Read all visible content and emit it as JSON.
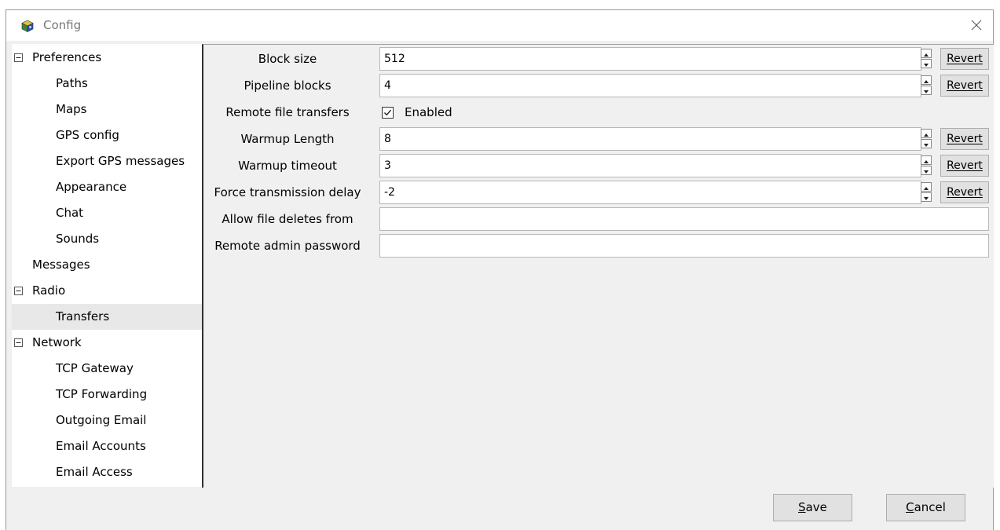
{
  "window": {
    "title": "Config",
    "close_glyph": "✕"
  },
  "tree": [
    {
      "label": "Preferences",
      "level": 0,
      "expander": "⊟",
      "selected": false
    },
    {
      "label": "Paths",
      "level": 1,
      "selected": false
    },
    {
      "label": "Maps",
      "level": 1,
      "selected": false
    },
    {
      "label": "GPS config",
      "level": 1,
      "selected": false
    },
    {
      "label": "Export GPS messages",
      "level": 1,
      "selected": false
    },
    {
      "label": "Appearance",
      "level": 1,
      "selected": false
    },
    {
      "label": "Chat",
      "level": 1,
      "selected": false
    },
    {
      "label": "Sounds",
      "level": 1,
      "selected": false
    },
    {
      "label": "Messages",
      "level": 0,
      "selected": false
    },
    {
      "label": "Radio",
      "level": 0,
      "expander": "⊟",
      "selected": false
    },
    {
      "label": "Transfers",
      "level": 1,
      "selected": true
    },
    {
      "label": "Network",
      "level": 0,
      "expander": "⊟",
      "selected": false
    },
    {
      "label": "TCP Gateway",
      "level": 1,
      "selected": false
    },
    {
      "label": "TCP Forwarding",
      "level": 1,
      "selected": false
    },
    {
      "label": "Outgoing Email",
      "level": 1,
      "selected": false
    },
    {
      "label": "Email Accounts",
      "level": 1,
      "selected": false
    },
    {
      "label": "Email Access",
      "level": 1,
      "selected": false
    }
  ],
  "settings": {
    "revert_label": "Revert",
    "block_size": {
      "label": "Block size",
      "value": "512"
    },
    "pipeline_blocks": {
      "label": "Pipeline blocks",
      "value": "4"
    },
    "remote_file_transfers": {
      "label": "Remote file transfers",
      "checkbox_label": "Enabled",
      "checked": true
    },
    "warmup_length": {
      "label": "Warmup Length",
      "value": "8"
    },
    "warmup_timeout": {
      "label": "Warmup timeout",
      "value": "3"
    },
    "force_transmission_delay": {
      "label": "Force transmission delay",
      "value": "-2"
    },
    "allow_file_deletes_from": {
      "label": "Allow file deletes from",
      "value": ""
    },
    "remote_admin_password": {
      "label": "Remote admin password",
      "value": ""
    }
  },
  "buttons": {
    "save_label": "Save",
    "cancel_label": "Cancel"
  }
}
